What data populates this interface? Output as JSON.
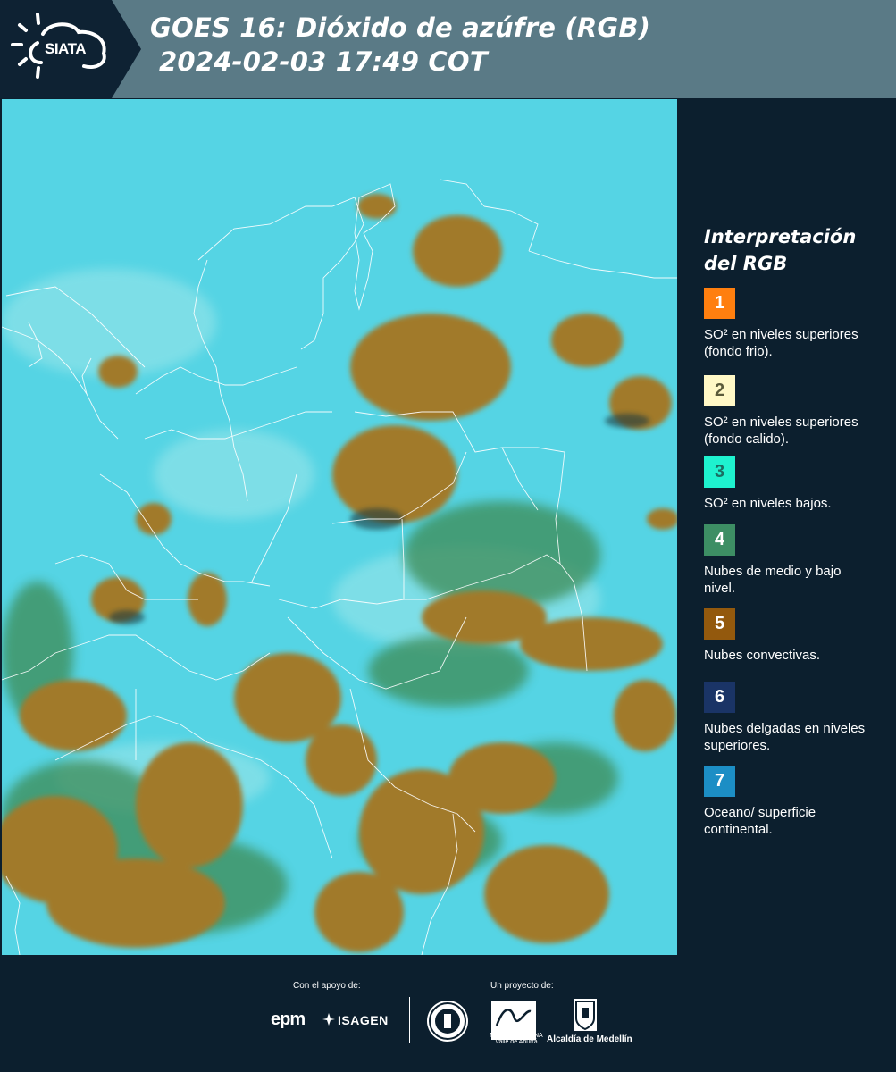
{
  "header": {
    "logo_text": "SIATA",
    "title_line1": "GOES 16: Dióxido de azúfre (RGB)",
    "title_line2": "2024-02-03 17:49 COT"
  },
  "legend": {
    "title_line1": "Interpretación",
    "title_line2": "del RGB",
    "items": [
      {
        "number": "1",
        "color": "#ff7f0f",
        "text_color": "#ffffff",
        "label": "SO² en niveles superiores (fondo frio)."
      },
      {
        "number": "2",
        "color": "#fff8c6",
        "text_color": "#5a5a3a",
        "label": "SO² en niveles superiores (fondo calido)."
      },
      {
        "number": "3",
        "color": "#1ef2cf",
        "text_color": "#1b6e62",
        "label": "SO² en niveles bajos."
      },
      {
        "number": "4",
        "color": "#3d8e64",
        "text_color": "#ffffff",
        "label": "Nubes de medio y bajo nivel."
      },
      {
        "number": "5",
        "color": "#93590d",
        "text_color": "#ffffff",
        "label": "Nubes convectivas."
      },
      {
        "number": "6",
        "color": "#1a3466",
        "text_color": "#ffffff",
        "label": "Nubes delgadas en niveles superiores."
      },
      {
        "number": "7",
        "color": "#1c8ec5",
        "text_color": "#ffffff",
        "label": "Oceano/ superficie continental."
      }
    ]
  },
  "footer": {
    "support_caption": "Con el apoyo de:",
    "project_caption": "Un proyecto de:",
    "sponsor_1": "epm",
    "sponsor_2": "ISAGEN",
    "partner_area": "METROPOLITANA Valle de Aburrá",
    "partner_alcaldia": "Alcaldía de Medellín"
  },
  "colors": {
    "background": "#0c1f2e",
    "header_band": "#5a7a86",
    "map_background": "#4cd3e2",
    "cloud_convective": "#a0792b",
    "cloud_low": "#3e8b55"
  }
}
